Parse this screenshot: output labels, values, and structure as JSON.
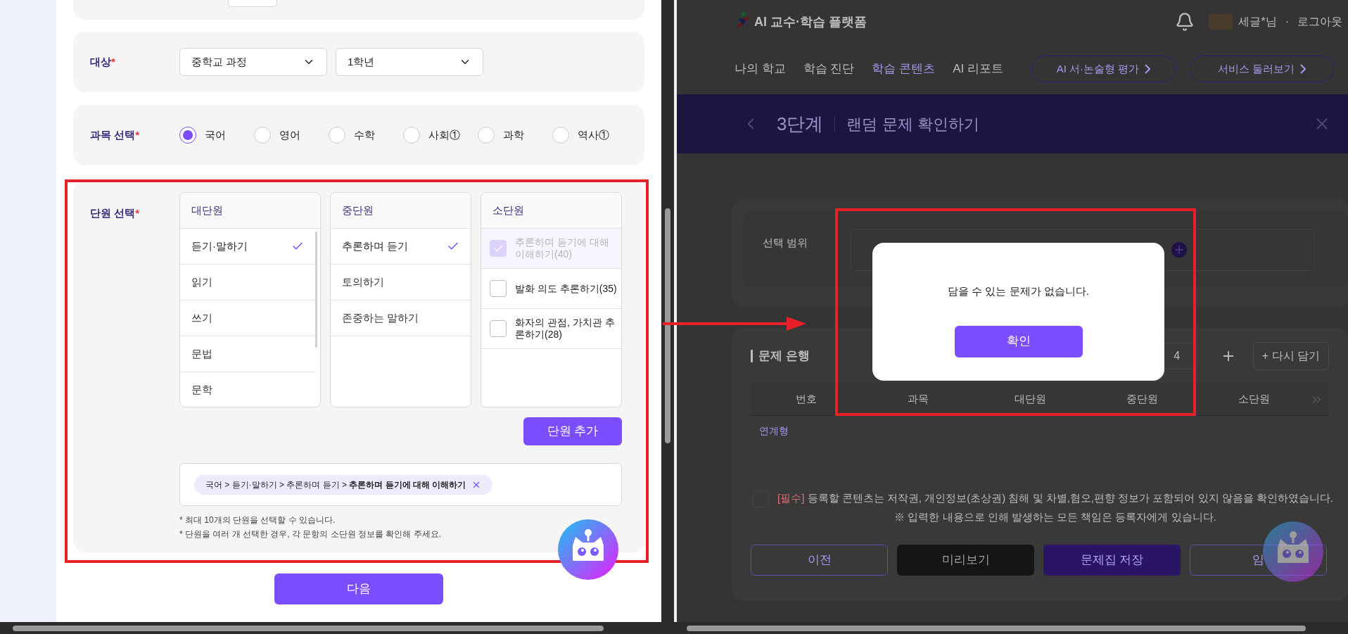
{
  "left_pane": {
    "target": {
      "label": "대상",
      "mark": "*",
      "selects": [
        {
          "value": "중학교 과정"
        },
        {
          "value": "1학년"
        }
      ]
    },
    "subject": {
      "label": "과목 선택",
      "mark": "*",
      "options": [
        {
          "label": "국어",
          "selected": true
        },
        {
          "label": "영어",
          "selected": false
        },
        {
          "label": "수학",
          "selected": false
        },
        {
          "label": "사회①",
          "selected": false
        },
        {
          "label": "과학",
          "selected": false
        },
        {
          "label": "역사①",
          "selected": false
        }
      ]
    },
    "units": {
      "label": "단원 선택",
      "mark": "*",
      "columns": [
        {
          "title": "대단원",
          "kind": "list",
          "items": [
            {
              "label": "듣기·말하기",
              "selected": true
            },
            {
              "label": "읽기",
              "selected": false
            },
            {
              "label": "쓰기",
              "selected": false
            },
            {
              "label": "문법",
              "selected": false
            },
            {
              "label": "문학",
              "selected": false
            }
          ]
        },
        {
          "title": "중단원",
          "kind": "list",
          "items": [
            {
              "label": "추론하며 듣기",
              "selected": true
            },
            {
              "label": "토의하기",
              "selected": false
            },
            {
              "label": "존중하는 말하기",
              "selected": false
            }
          ]
        },
        {
          "title": "소단원",
          "kind": "checklist",
          "items": [
            {
              "label": "추론하며 듣기에 대해 이해하기(40)",
              "checked": true,
              "disabled": true
            },
            {
              "label": "발화 의도 추론하기(35)",
              "checked": false,
              "disabled": false
            },
            {
              "label": "화자의 관점, 가치관 추론하기(28)",
              "checked": false,
              "disabled": false
            }
          ]
        }
      ],
      "add_button": "단원 추가",
      "chips": [
        {
          "path": "국어 > 듣기·말하기 > 추론하며 듣기 > ",
          "last": "추론하며 듣기에 대해 이해하기"
        }
      ],
      "notes": [
        "* 최대 10개의 단원을 선택할 수 있습니다.",
        "* 단원을 여러 개 선택한 경우, 각 문항의 소단원 정보를 확인해 주세요."
      ]
    },
    "next_button": "다음"
  },
  "right_pane": {
    "logo": "AI 교수·학습 플랫폼",
    "user": "세글*님",
    "separator": "·",
    "logout": "로그아웃",
    "nav": [
      {
        "label": "나의 학교",
        "selected": false
      },
      {
        "label": "학습 진단",
        "selected": false
      },
      {
        "label": "학습 콘텐츠",
        "selected": true
      },
      {
        "label": "AI 리포트",
        "selected": false
      }
    ],
    "pill_buttons": [
      "AI 서·논술형 평가",
      "서비스 둘러보기"
    ],
    "banner": {
      "step": "3단계",
      "title": "랜덤 문제 확인하기"
    },
    "range_label": "선택 범위",
    "bank": {
      "title": "문제 은행",
      "count": "4",
      "re_add": "+ 다시 담기",
      "columns": [
        "번호",
        "과목",
        "대단원",
        "중단원",
        "소단원"
      ],
      "group": "연계형"
    },
    "agreement": {
      "checked": false,
      "tag": "[필수]",
      "text": "등록할 콘텐츠는 저작권, 개인정보(초상권) 침해 및 차별,혐오,편향 정보가 포함되어 있지 않음을 확인하였습니다.",
      "note": "※ 입력한 내용으로 인해 발생하는 모든 책임은 등록자에게 있습니다."
    },
    "buttons": [
      {
        "label": "이전",
        "kind": "outline"
      },
      {
        "label": "미리보기",
        "kind": "dark"
      },
      {
        "label": "문제집 저장",
        "kind": "primary"
      },
      {
        "label": "임",
        "kind": "outline"
      }
    ],
    "modal": {
      "message": "담을 수 있는 문제가 없습니다.",
      "confirm": "확인"
    }
  }
}
